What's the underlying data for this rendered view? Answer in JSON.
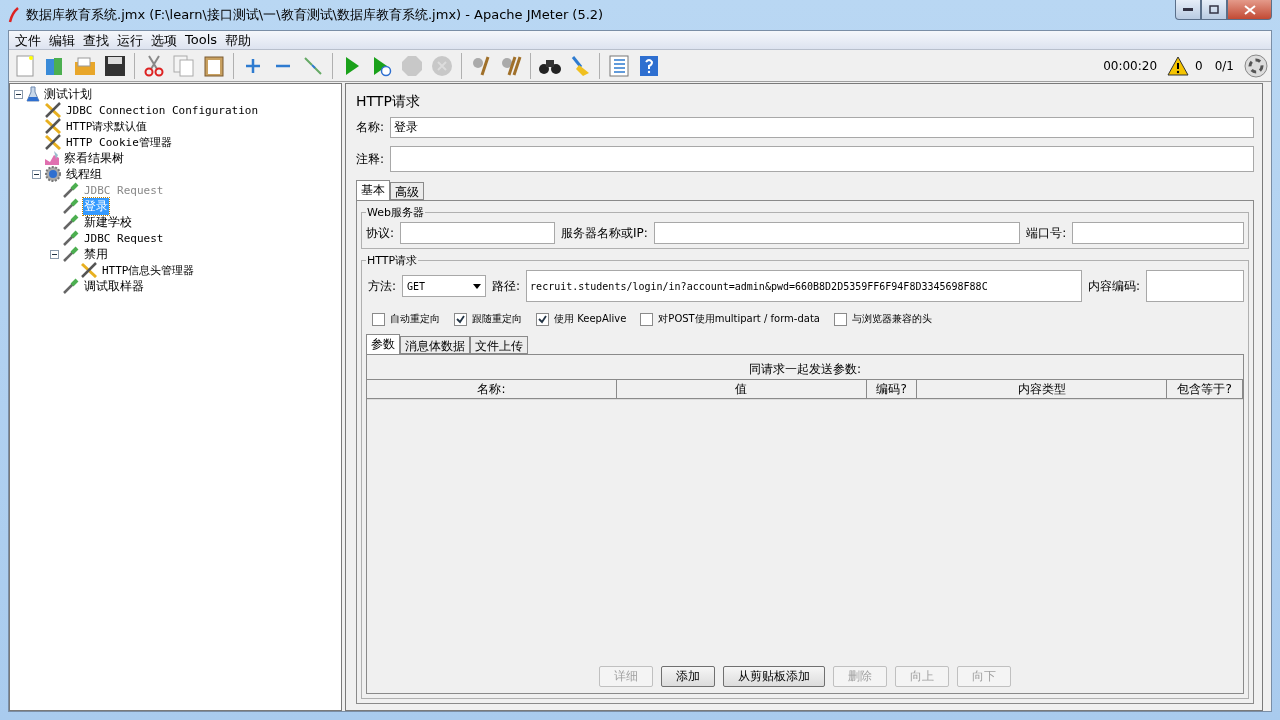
{
  "window": {
    "title": "数据库教育系统.jmx (F:\\learn\\接口测试\\一\\教育测试\\数据库教育系统.jmx) - Apache JMeter (5.2)"
  },
  "menu": [
    {
      "label": "文件"
    },
    {
      "label": "编辑"
    },
    {
      "label": "查找"
    },
    {
      "label": "运行"
    },
    {
      "label": "选项"
    },
    {
      "label": "Tools"
    },
    {
      "label": "帮助"
    }
  ],
  "toolbar": [
    [
      {
        "kind": "new",
        "disabled": false
      },
      {
        "kind": "templates",
        "disabled": false
      },
      {
        "kind": "open",
        "disabled": false
      },
      {
        "kind": "save",
        "disabled": false
      }
    ],
    [
      {
        "kind": "cut",
        "disabled": false
      },
      {
        "kind": "copy",
        "disabled": false
      },
      {
        "kind": "paste",
        "disabled": false
      }
    ],
    [
      {
        "kind": "expand",
        "disabled": false
      },
      {
        "kind": "collapse",
        "disabled": false
      },
      {
        "kind": "toggle",
        "disabled": false
      }
    ],
    [
      {
        "kind": "start",
        "disabled": false
      },
      {
        "kind": "start-no-pause",
        "disabled": false
      },
      {
        "kind": "stop",
        "disabled": true
      },
      {
        "kind": "shutdown",
        "disabled": true
      }
    ],
    [
      {
        "kind": "clear",
        "disabled": false
      },
      {
        "kind": "clear-all",
        "disabled": false
      }
    ],
    [
      {
        "kind": "search",
        "disabled": false
      },
      {
        "kind": "reset-search",
        "disabled": false
      }
    ],
    [
      {
        "kind": "function",
        "disabled": false
      },
      {
        "kind": "help",
        "disabled": false
      }
    ]
  ],
  "status": {
    "timer": "00:00:20",
    "warnings": "0",
    "threads": "0/1"
  },
  "tree": [
    {
      "label": "测试计划",
      "kind": "plan",
      "selected": false,
      "disabled": false,
      "expanded": true,
      "children": [
        {
          "label": "JDBC Connection Configuration",
          "kind": "config",
          "selected": false,
          "disabled": false
        },
        {
          "label": "HTTP请求默认值",
          "kind": "config",
          "selected": false,
          "disabled": false
        },
        {
          "label": "HTTP Cookie管理器",
          "kind": "config",
          "selected": false,
          "disabled": false
        },
        {
          "label": "察看结果树",
          "kind": "listener",
          "selected": false,
          "disabled": false
        },
        {
          "label": "线程组",
          "kind": "threadgroup",
          "selected": false,
          "disabled": false,
          "expanded": true,
          "children": [
            {
              "label": "JDBC Request",
              "kind": "sampler",
              "selected": false,
              "disabled": true
            },
            {
              "label": "登录",
              "kind": "sampler",
              "selected": true,
              "disabled": false
            },
            {
              "label": "新建学校",
              "kind": "sampler",
              "selected": false,
              "disabled": false
            },
            {
              "label": "JDBC Request",
              "kind": "sampler",
              "selected": false,
              "disabled": false
            },
            {
              "label": "禁用",
              "kind": "sampler",
              "selected": false,
              "disabled": false,
              "expanded": true,
              "children": [
                {
                  "label": "HTTP信息头管理器",
                  "kind": "config",
                  "selected": false,
                  "disabled": false
                }
              ]
            },
            {
              "label": "调试取样器",
              "kind": "sampler",
              "selected": false,
              "disabled": false
            }
          ]
        }
      ]
    }
  ],
  "panel": {
    "title": "HTTP请求",
    "name": {
      "label": "名称:",
      "value": "登录"
    },
    "comment": {
      "label": "注释:"
    },
    "tabs": [
      {
        "label": "基本",
        "selected": true
      },
      {
        "label": "高级",
        "selected": false
      }
    ],
    "web_server": {
      "legend": "Web服务器",
      "fields": [
        {
          "label": "协议:"
        },
        {
          "label": "服务器名称或IP:"
        },
        {
          "label": "端口号:"
        }
      ]
    },
    "http": {
      "legend": "HTTP请求",
      "method": {
        "label": "方法:",
        "value": "GET"
      },
      "path": {
        "label": "路径:",
        "value": "recruit.students/login/in?account=admin&pwd=660B8D2D5359FF6F94F8D3345698F88C"
      },
      "encoding": {
        "label": "内容编码:"
      },
      "checkboxes": [
        {
          "label": "自动重定向",
          "checked": false
        },
        {
          "label": "跟随重定向",
          "checked": true
        },
        {
          "label": "使用 KeepAlive",
          "checked": true
        },
        {
          "label": "对POST使用multipart / form-data",
          "checked": false
        },
        {
          "label": "与浏览器兼容的头",
          "checked": false
        }
      ]
    },
    "subtabs": [
      {
        "label": "参数",
        "selected": true
      },
      {
        "label": "消息体数据",
        "selected": false
      },
      {
        "label": "文件上传",
        "selected": false
      }
    ],
    "params": {
      "caption": "同请求一起发送参数:",
      "columns": [
        {
          "label": "名称:"
        },
        {
          "label": "值"
        },
        {
          "label": "编码?"
        },
        {
          "label": "内容类型"
        },
        {
          "label": "包含等于?"
        }
      ]
    },
    "buttons": [
      {
        "label": "详细",
        "disabled": true
      },
      {
        "label": "添加",
        "disabled": false
      },
      {
        "label": "从剪贴板添加",
        "disabled": false
      },
      {
        "label": "删除",
        "disabled": true
      },
      {
        "label": "向上",
        "disabled": true
      },
      {
        "label": "向下",
        "disabled": true
      }
    ]
  }
}
